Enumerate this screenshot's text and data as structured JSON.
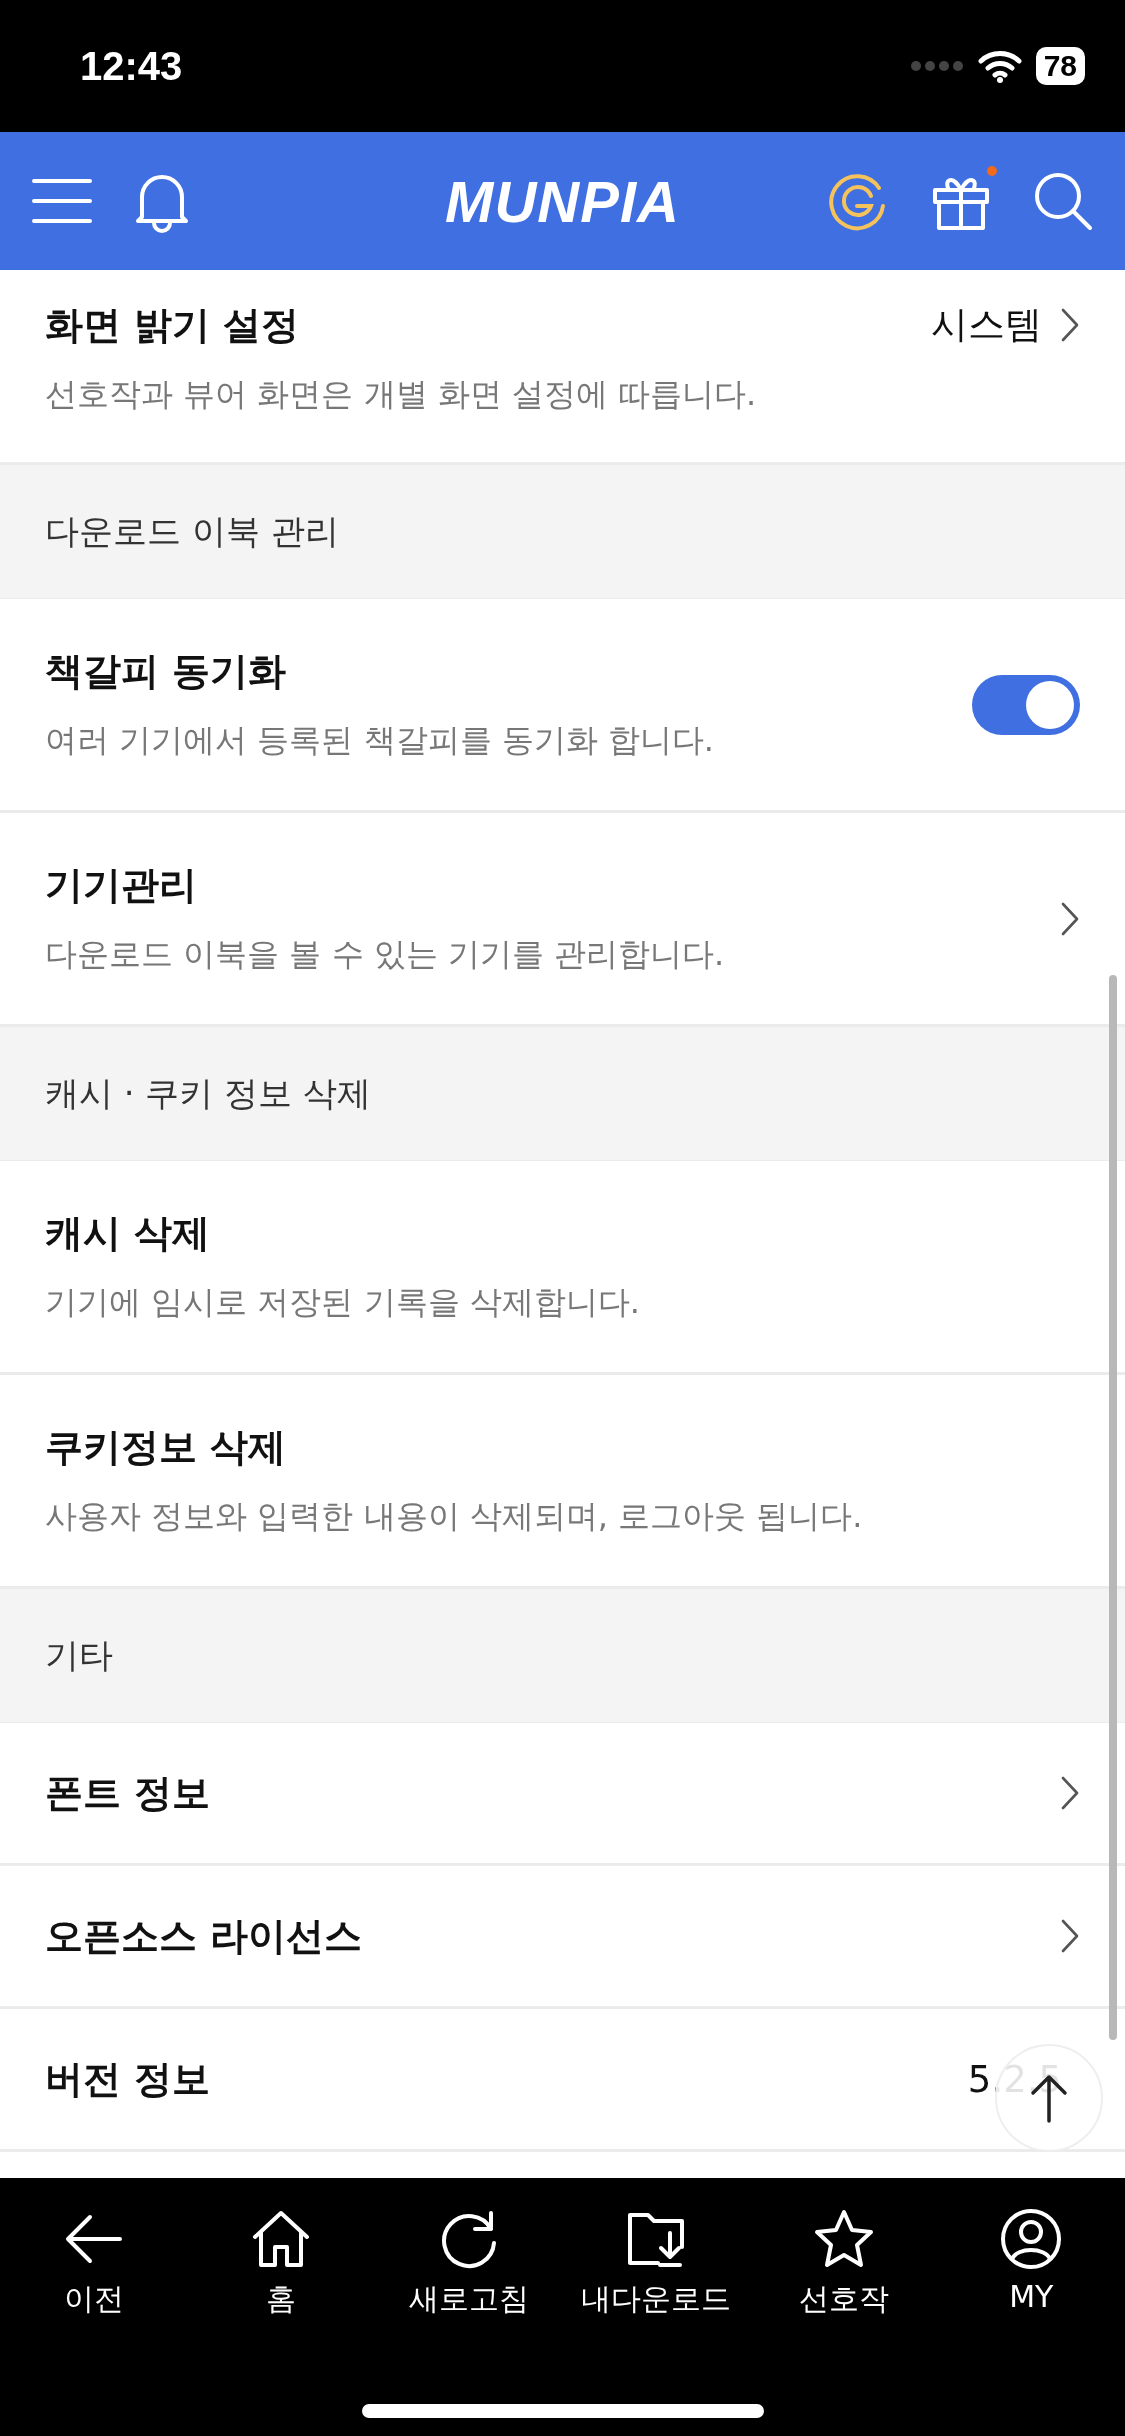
{
  "status_bar": {
    "time": "12:43",
    "battery": "78"
  },
  "header": {
    "logo": "MUNPIA",
    "gift_badge": true
  },
  "sections": [
    {
      "items": [
        {
          "kind": "link",
          "title": "화면 밝기 설정",
          "value": "시스템",
          "description": "선호작과 뷰어 화면은 개별 화면 설정에 따릅니다."
        }
      ]
    },
    {
      "heading": "다운로드 이북 관리",
      "items": [
        {
          "kind": "toggle",
          "title": "책갈피 동기화",
          "description": "여러 기기에서 등록된 책갈피를 동기화 합니다.",
          "on": true
        },
        {
          "kind": "link",
          "title": "기기관리",
          "description": "다운로드 이북을 볼 수 있는 기기를 관리합니다."
        }
      ]
    },
    {
      "heading": "캐시 · 쿠키 정보 삭제",
      "items": [
        {
          "kind": "plain",
          "title": "캐시 삭제",
          "description": "기기에 임시로 저장된 기록을 삭제합니다."
        },
        {
          "kind": "plain",
          "title": "쿠키정보 삭제",
          "description": "사용자 정보와 입력한 내용이 삭제되며, 로그아웃 됩니다."
        }
      ]
    },
    {
      "heading": "기타",
      "items": [
        {
          "kind": "link",
          "title": "폰트 정보"
        },
        {
          "kind": "link",
          "title": "오픈소스 라이선스"
        },
        {
          "kind": "info",
          "title": "버전 정보",
          "value": "5.2.5"
        }
      ]
    }
  ],
  "bottom_nav": [
    {
      "label": "이전",
      "kind": "back"
    },
    {
      "label": "홈",
      "kind": "home"
    },
    {
      "label": "새로고침",
      "kind": "refresh"
    },
    {
      "label": "내다운로드",
      "kind": "download"
    },
    {
      "label": "선호작",
      "kind": "star"
    },
    {
      "label": "MY",
      "kind": "user"
    }
  ]
}
